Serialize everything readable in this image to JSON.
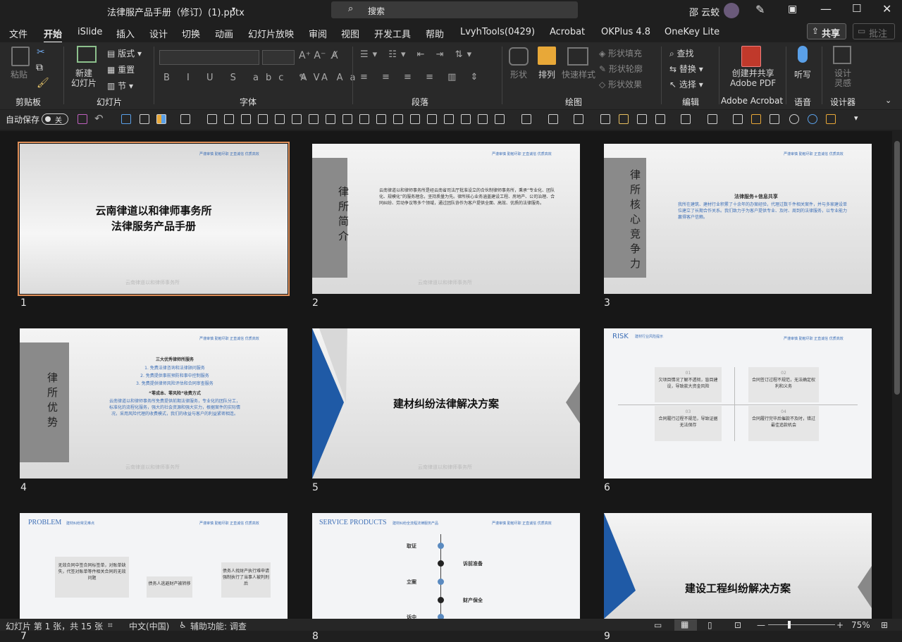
{
  "titlebar": {
    "filename": "法律服产品手册（修订）(1).pptx",
    "search": "搜索",
    "user": "邵 云蛟"
  },
  "menu": [
    "文件",
    "开始",
    "iSlide",
    "插入",
    "设计",
    "切换",
    "动画",
    "幻灯片放映",
    "审阅",
    "视图",
    "开发工具",
    "帮助",
    "LvyhTools(0429)",
    "Acrobat",
    "OKPlus 4.8",
    "OneKey Lite"
  ],
  "share": "共享",
  "comment": "批注",
  "ribbon": {
    "paste": "粘贴",
    "new_slide": "新建\n幻灯片",
    "layout": "版式",
    "reset": "重置",
    "section": "节",
    "shape": "形状",
    "arrange": "排列",
    "quick_style": "快速样式",
    "fill": "形状填充",
    "outline": "形状轮廓",
    "effect": "形状效果",
    "find": "查找",
    "replace": "替换",
    "select": "选择",
    "create_pdf": "创建并共享\nAdobe PDF",
    "dictate": "听写",
    "designer": "设计\n灵感",
    "groups": [
      "剪贴板",
      "幻灯片",
      "字体",
      "段落",
      "绘图",
      "编辑",
      "Adobe Acrobat",
      "语音",
      "设计器"
    ]
  },
  "qat": {
    "autosave": "自动保存",
    "toggle": "关"
  },
  "slides": [
    {
      "n": "1",
      "title": "云南律道以和律师事务所\n法律服务产品手册",
      "tag": "严谨审慎 勤勉尽职 正直诚信 优质高效",
      "wm": "云南律道以和律师事务所"
    },
    {
      "n": "2",
      "vert": "律所简介",
      "tag": "严谨审慎 勤勉尽职 正直诚信 优质高效",
      "body": "云南律道以和律师事务所是经云南省司法厅批准设立的合伙制律师事务所，秉承“专业化、团队化、规模化”的服务理念，坚持质量为先。律所核心业务涵盖建设工程、房地产、公司治理、合同纠纷、劳动争议等多个领域，通过团队协作为客户提供全面、高效、优质的法律服务。",
      "wm": "云南律道以和律师事务所"
    },
    {
      "n": "3",
      "vert": "律所核心竞争力",
      "tag": "严谨审慎 勤勉尽职 正直诚信 优质高效",
      "heading": "法律服务+信息共享",
      "body": "我所在建筑、建材行业积累了十余年的办案经验，代理过数千件相关案件，并与多家建设单位建立了长期合作关系。我们致力于为客户提供专业、及时、周到的法律服务，以专业能力赢得客户信赖。"
    },
    {
      "n": "4",
      "vert": "律所优势",
      "tag": "严谨审慎 勤勉尽职 正直诚信 优质高效",
      "heading": "三大优秀律师所服务",
      "items": [
        "1. 免费法律咨询和法律顾问服务",
        "2. 免费提供事前预防和事中控制服务",
        "3. 免费提供律师风险评估和合同审查服务"
      ],
      "sub": "“零成本、零风险”收费方式",
      "body": "云南律道以和律师事务所免费提供前期法律服务，专业化的团队分工，标准化的流程化服务，强大的社会资源和强大实力，根据案件的实际情况，采用风险代理的收费模式，我们的收益与客户的利益紧密相连。",
      "wm": "云南律道以和律师事务所"
    },
    {
      "n": "5",
      "title": "建材纠纷法律解决方案",
      "wm": "云南律道以和律师事务所"
    },
    {
      "n": "6",
      "head": "RISK",
      "headsub": "建材行业风险提示",
      "tag": "严谨审慎 勤勉尽职 正直诚信 优质高效",
      "cells": [
        {
          "k": "01",
          "t": "欠项目情况了解不透彻，盲目建设，导致款大资金风险"
        },
        {
          "k": "02",
          "t": "合同签订过程不规范，无法确定权利和义务"
        },
        {
          "k": "03",
          "t": "合同履行过程不规范，导致证据无法保存"
        },
        {
          "k": "04",
          "t": "合同履行完毕后催款不及时，错过最佳追款机会"
        }
      ]
    },
    {
      "n": "7",
      "head": "PROBLEM",
      "headsub": "建材纠纷常见难点",
      "tag": "严谨审慎 勤勉尽职 正直诚信 优质高效",
      "boxes": [
        "无效合同中签合同标签单，对账单缺失，代签对账单等件相关合同的无效问题",
        "债务人逃避财产被转移",
        "债务人找财产执行难申请强制执行了当事人被判刑后"
      ]
    },
    {
      "n": "8",
      "head": "SERVICE PRODUCTS",
      "headsub": "建材纠纷全流程法律服务产品",
      "tag": "严谨审慎 勤勉尽职 正直诚信 优质高效",
      "nodes": [
        "取证",
        "诉前准备",
        "立案",
        "财产保全",
        "诉中"
      ]
    },
    {
      "n": "9",
      "title": "建设工程纠纷解决方案"
    }
  ],
  "status": {
    "slide": "幻灯片 第 1 张，共 15 张",
    "lang": "中文(中国)",
    "access": "辅助功能: 调查",
    "zoom": "75%"
  }
}
